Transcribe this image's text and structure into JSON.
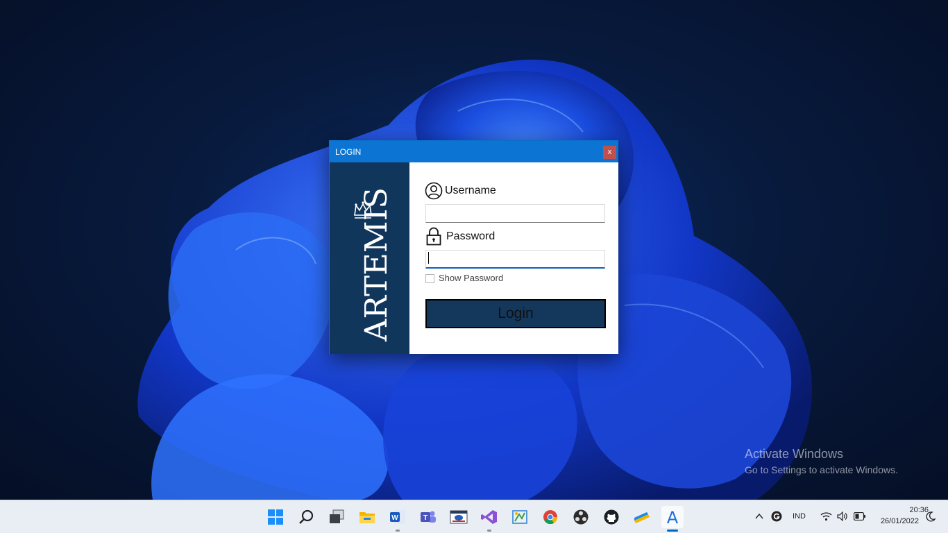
{
  "window": {
    "title": "LOGIN",
    "close_label": "x"
  },
  "brand": {
    "logo_text": "ARTEMIS"
  },
  "form": {
    "username_label": "Username",
    "username_value": "",
    "password_label": "Password",
    "password_value": "",
    "show_password_label": "Show Password",
    "show_password_checked": false,
    "login_label": "Login"
  },
  "watermark": {
    "title": "Activate Windows",
    "subtitle": "Go to Settings to activate Windows."
  },
  "taskbar": {
    "apps": [
      {
        "name": "start-icon"
      },
      {
        "name": "search-icon"
      },
      {
        "name": "task-view-icon"
      },
      {
        "name": "file-explorer-icon"
      },
      {
        "name": "word-icon"
      },
      {
        "name": "teams-icon"
      },
      {
        "name": "app-window-icon"
      },
      {
        "name": "visual-studio-icon"
      },
      {
        "name": "snipping-icon"
      },
      {
        "name": "chrome-icon"
      },
      {
        "name": "obs-icon"
      },
      {
        "name": "github-icon"
      },
      {
        "name": "notes-icon"
      },
      {
        "name": "artemis-app-icon"
      }
    ],
    "tray": {
      "language": "IND",
      "time": "20:36",
      "date": "26/01/2022"
    }
  },
  "colors": {
    "title_bar": "#0c75d3",
    "brand_panel": "#10365c",
    "login_button": "#14375c",
    "close_button": "#c0504d",
    "taskbar": "#e9eef5"
  }
}
